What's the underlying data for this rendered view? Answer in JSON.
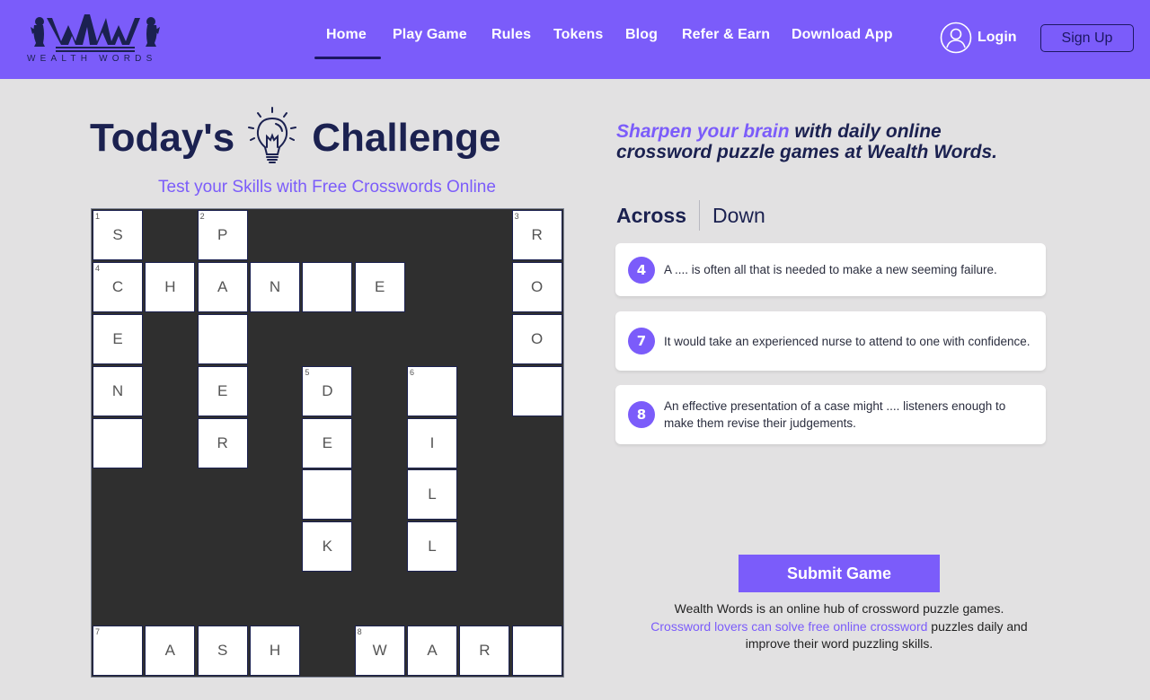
{
  "brand": {
    "name": "WEALTH WORDS",
    "monogram": "WAW",
    "primary_color": "#7b5cfa",
    "navy_color": "#1b2150"
  },
  "nav": {
    "items": [
      {
        "label": "Home",
        "active": true
      },
      {
        "label": "Play Game",
        "active": false
      },
      {
        "label": "Rules",
        "active": false
      },
      {
        "label": "Tokens",
        "active": false
      },
      {
        "label": "Blog",
        "active": false
      },
      {
        "label": "Refer & Earn",
        "active": false
      },
      {
        "label": "Download App",
        "active": false
      }
    ],
    "login_label": "Login",
    "login_icon": "user-circle-icon",
    "signup_label": "Sign Up"
  },
  "challenge": {
    "title_before": "Today's",
    "title_after": "Challenge",
    "title_icon": "lightbulb-icon",
    "subtitle": "Test your Skills with Free Crosswords Online"
  },
  "crossword": {
    "rows": 9,
    "cols": 9,
    "cells": [
      {
        "r": 0,
        "c": 0,
        "num": "1",
        "letter": "S"
      },
      {
        "r": 0,
        "c": 2,
        "num": "2",
        "letter": "P"
      },
      {
        "r": 0,
        "c": 8,
        "num": "3",
        "letter": "R"
      },
      {
        "r": 1,
        "c": 0,
        "num": "4",
        "letter": "C"
      },
      {
        "r": 1,
        "c": 1,
        "num": "",
        "letter": "H"
      },
      {
        "r": 1,
        "c": 2,
        "num": "",
        "letter": "A"
      },
      {
        "r": 1,
        "c": 3,
        "num": "",
        "letter": "N"
      },
      {
        "r": 1,
        "c": 4,
        "num": "",
        "letter": ""
      },
      {
        "r": 1,
        "c": 5,
        "num": "",
        "letter": "E"
      },
      {
        "r": 1,
        "c": 8,
        "num": "",
        "letter": "O"
      },
      {
        "r": 2,
        "c": 0,
        "num": "",
        "letter": "E"
      },
      {
        "r": 2,
        "c": 2,
        "num": "",
        "letter": ""
      },
      {
        "r": 2,
        "c": 8,
        "num": "",
        "letter": "O"
      },
      {
        "r": 3,
        "c": 0,
        "num": "",
        "letter": "N"
      },
      {
        "r": 3,
        "c": 2,
        "num": "",
        "letter": "E"
      },
      {
        "r": 3,
        "c": 4,
        "num": "5",
        "letter": "D"
      },
      {
        "r": 3,
        "c": 6,
        "num": "6",
        "letter": ""
      },
      {
        "r": 3,
        "c": 8,
        "num": "",
        "letter": ""
      },
      {
        "r": 4,
        "c": 0,
        "num": "",
        "letter": ""
      },
      {
        "r": 4,
        "c": 2,
        "num": "",
        "letter": "R"
      },
      {
        "r": 4,
        "c": 4,
        "num": "",
        "letter": "E"
      },
      {
        "r": 4,
        "c": 6,
        "num": "",
        "letter": "I"
      },
      {
        "r": 5,
        "c": 4,
        "num": "",
        "letter": ""
      },
      {
        "r": 5,
        "c": 6,
        "num": "",
        "letter": "L"
      },
      {
        "r": 6,
        "c": 4,
        "num": "",
        "letter": "K"
      },
      {
        "r": 6,
        "c": 6,
        "num": "",
        "letter": "L"
      },
      {
        "r": 8,
        "c": 0,
        "num": "7",
        "letter": ""
      },
      {
        "r": 8,
        "c": 1,
        "num": "",
        "letter": "A"
      },
      {
        "r": 8,
        "c": 2,
        "num": "",
        "letter": "S"
      },
      {
        "r": 8,
        "c": 3,
        "num": "",
        "letter": "H"
      },
      {
        "r": 8,
        "c": 5,
        "num": "8",
        "letter": "W"
      },
      {
        "r": 8,
        "c": 6,
        "num": "",
        "letter": "A"
      },
      {
        "r": 8,
        "c": 7,
        "num": "",
        "letter": "R"
      },
      {
        "r": 8,
        "c": 8,
        "num": "",
        "letter": ""
      }
    ]
  },
  "side": {
    "tagline_accent": "Sharpen your brain",
    "tagline_rest": " with daily online crossword puzzle games at Wealth Words.",
    "tabs": [
      {
        "label": "Across",
        "active": true
      },
      {
        "label": "Down",
        "active": false
      }
    ],
    "clues": [
      {
        "num": "4",
        "text": "A .... is often all that is needed to make a new seeming failure."
      },
      {
        "num": "7",
        "text": "It would take an experienced nurse to attend to one with confidence."
      },
      {
        "num": "8",
        "text": "An effective presentation of a case might .... listeners enough to make them revise their judgements."
      }
    ],
    "submit_label": "Submit Game",
    "about_line1": "Wealth Words is an online hub of crossword puzzle games.",
    "about_link": "Crossword lovers can solve free online crossword",
    "about_rest": " puzzles daily and improve their word puzzling skills."
  }
}
